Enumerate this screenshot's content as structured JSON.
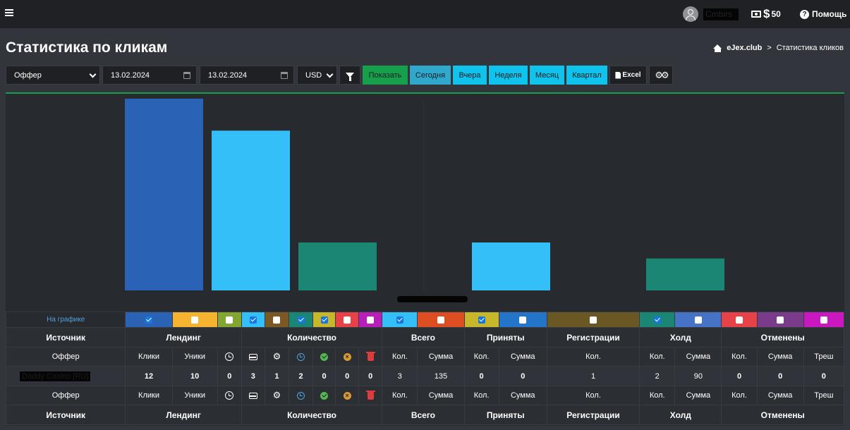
{
  "topbar": {
    "username": "Cmbirs",
    "balance": "50",
    "help_label": "Помощь"
  },
  "page": {
    "title": "Статистика по кликам"
  },
  "breadcrumb": {
    "site": "eJex.club",
    "separator": ">",
    "current": "Статистика кликов"
  },
  "toolbar": {
    "group_by": "Оффер",
    "date_from": "13.02.2024",
    "date_to": "13.02.2024",
    "currency": "USD",
    "show_label": "Показать",
    "today_label": "Сегодня",
    "yesterday_label": "Вчера",
    "week_label": "Неделя",
    "month_label": "Месяц",
    "quarter_label": "Квартал",
    "excel_label": "Excel"
  },
  "colors": {
    "show": "#17a04c",
    "today": "#30a8cc",
    "period": "#10c3ec"
  },
  "chart_data": {
    "type": "bar",
    "categories": [
      "Клики",
      "Уники",
      "Количество",
      "Всего",
      "Принято",
      "Регистрации",
      "Холд"
    ],
    "values": [
      12,
      10,
      3,
      3,
      0,
      1,
      2
    ],
    "x_label": "Daddy Casino [RU]",
    "colors": [
      "#2a62b6",
      "#35bff9",
      "#1b8673",
      "#35bff9",
      "#c9b72b",
      "#9c852b",
      "#1b8673"
    ]
  },
  "toggles": {
    "label": "На графике",
    "colors": [
      "#2a62b6",
      "#f5b330",
      "#82a630",
      "#35bff9",
      "#7a5a22",
      "#1b8673",
      "#c9b72b",
      "#e84249",
      "#b81fb9",
      "#35bff9",
      "#dd4f23",
      "#c9b72b",
      "#2475c9",
      "#6a5824",
      "#1b8673",
      "#4673c6",
      "#e84249",
      "#7a3c8a",
      "#c918c0"
    ],
    "checked": [
      true,
      false,
      false,
      true,
      false,
      true,
      true,
      false,
      false,
      true,
      false,
      true,
      false,
      false,
      true,
      false,
      false,
      false,
      false
    ]
  },
  "table": {
    "groups": [
      "Источник",
      "Лендинг",
      "Количество",
      "Всего",
      "Приняты",
      "Регистрации",
      "Холд",
      "Отменены"
    ],
    "subs": {
      "source": "Оффер",
      "clicks": "Клики",
      "uniques": "Уники",
      "count": "Кол.",
      "sum": "Сумма",
      "trash": "Треш"
    },
    "row": {
      "name": "Daddy Casino [RU]",
      "clicks": "12",
      "uniques": "10",
      "land_pending": "0",
      "inbox": "3",
      "processing": "1",
      "waiting": "2",
      "approved": "0",
      "cancelled": "0",
      "deleted": "0",
      "total_count": "3",
      "total_sum": "135",
      "acc_count": "0",
      "acc_sum": "0",
      "reg_count": "1",
      "hold_count": "2",
      "hold_sum": "90",
      "cancel_count": "0",
      "cancel_sum": "0",
      "cancel_trash": "0"
    }
  }
}
